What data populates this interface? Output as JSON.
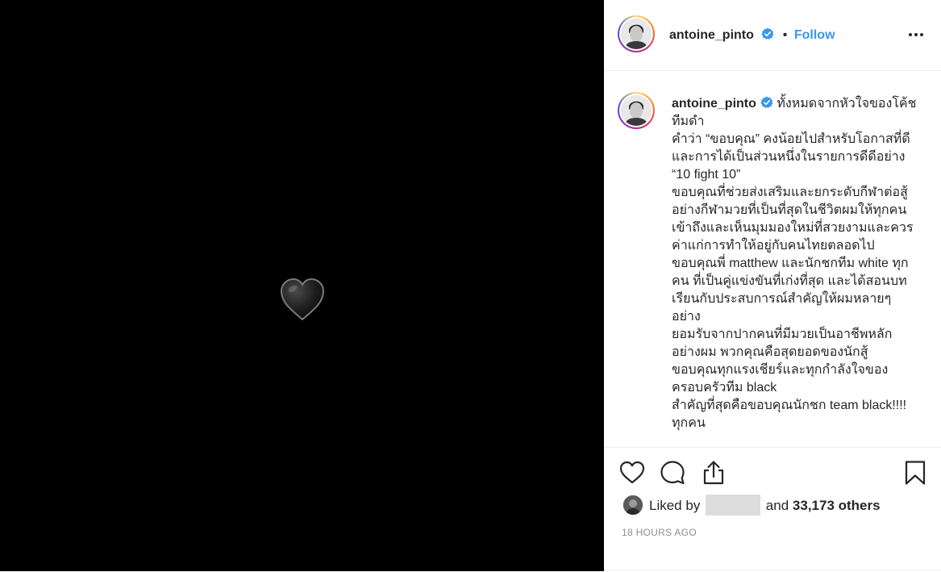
{
  "post": {
    "author": "antoine_pinto",
    "follow_label": "Follow",
    "separator": "•",
    "media_emoji": "black-heart"
  },
  "caption": {
    "username": "antoine_pinto",
    "lines": [
      "ทั้งหมดจากหัวใจของโค้ชทีมดำ",
      "คำว่า “ขอบคุณ” คงน้อยไปสำหรับโอกาสที่ดี และการได้เป็นส่วนหนึ่งในรายการดีดีอย่าง “10 fight 10”",
      "ขอบคุณที่ช่วยส่งเสริมและยกระดับกีฬาต่อสู้ อย่างกีฬามวยที่เป็นที่สุดในชีวิตผมให้ทุกคนเข้าถึงและเห็นมุมมองใหม่ที่สวยงามและควรค่าแก่การทำให้อยู่กับคนไทยตลอดไป",
      "ขอบคุณพี่ matthew และนักชกทีม white ทุกคน ที่เป็นคู่แข่งขันที่เก่งที่สุด และได้สอนบทเรียนกับประสบการณ์สำคัญให้ผมหลายๆ อย่าง",
      "ยอมรับจากปากคนที่มีมวยเป็นอาชีพหลักอย่างผม พวกคุณคือสุดยอดของนักสู้",
      "ขอบคุณทุกแรงเชียร์และทุกกำลังใจของครอบครัวทีม black",
      "สำคัญที่สุดคือขอบคุณนักชก team black!!!! ทุกคน"
    ]
  },
  "likes": {
    "prefix": "Liked by",
    "connector": "and",
    "count_text": "33,173 others"
  },
  "timestamp": "18 HOURS AGO",
  "colors": {
    "accent": "#3897f0",
    "text": "#262626",
    "muted": "#8e8e8e",
    "media_bg": "#000000"
  }
}
